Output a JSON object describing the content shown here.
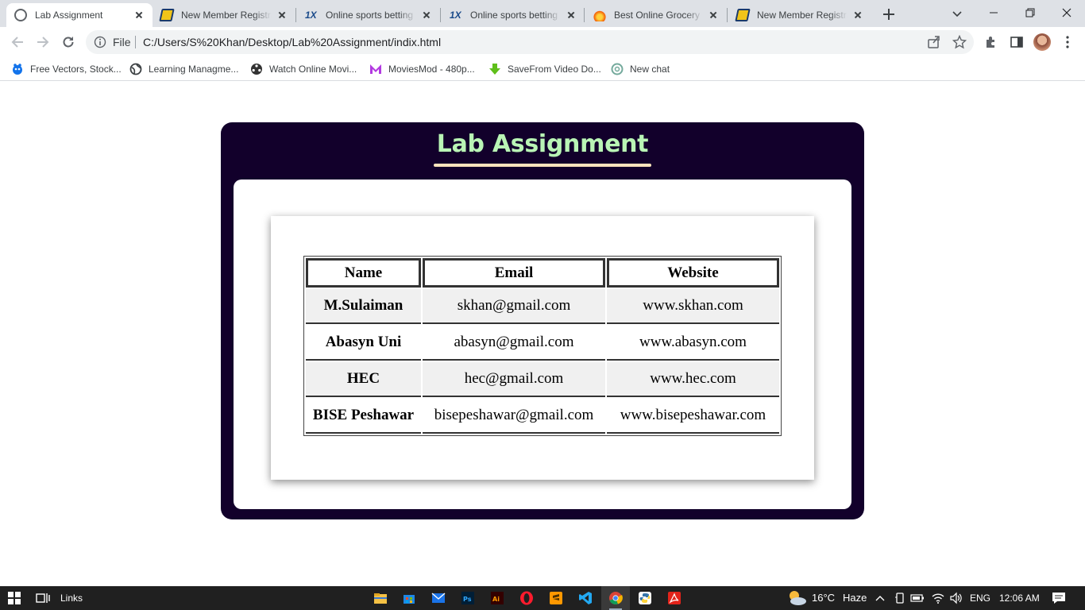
{
  "browser": {
    "tabs": [
      {
        "label": "Lab Assignment",
        "icon": "globe-icon",
        "active": true
      },
      {
        "label": "New Member Registra",
        "icon": "betting-site-icon",
        "active": false
      },
      {
        "label": "Online sports betting",
        "icon": "1x-icon",
        "active": false
      },
      {
        "label": "Online sports betting",
        "icon": "1x-icon",
        "active": false
      },
      {
        "label": "Best Online Grocery St",
        "icon": "flame-icon",
        "active": false
      },
      {
        "label": "New Member Registra",
        "icon": "betting-site-icon",
        "active": false
      }
    ],
    "address": {
      "scheme": "File",
      "url": "C:/Users/S%20Khan/Desktop/Lab%20Assignment/indix.html"
    },
    "bookmarks": [
      {
        "label": "Free Vectors, Stock...",
        "icon": "freepik-icon"
      },
      {
        "label": "Learning Managme...",
        "icon": "globe-icon"
      },
      {
        "label": "Watch Online Movi...",
        "icon": "film-reel-icon"
      },
      {
        "label": "MoviesMod - 480p...",
        "icon": "m-logo-icon"
      },
      {
        "label": "SaveFrom Video Do...",
        "icon": "download-arrow-icon"
      },
      {
        "label": "New chat",
        "icon": "chatgpt-icon"
      }
    ]
  },
  "page": {
    "title": "Lab Assignment",
    "table": {
      "headers": [
        "Name",
        "Email",
        "Website"
      ],
      "rows": [
        {
          "name": "M.Sulaiman",
          "email": "skhan@gmail.com",
          "website": "www.skhan.com"
        },
        {
          "name": "Abasyn Uni",
          "email": "abasyn@gmail.com",
          "website": "www.abasyn.com"
        },
        {
          "name": "HEC",
          "email": "hec@gmail.com",
          "website": "www.hec.com"
        },
        {
          "name": "BISE Peshawar",
          "email": "bisepeshawar@gmail.com",
          "website": "www.bisepeshawar.com"
        }
      ]
    }
  },
  "taskbar": {
    "search_label": "Links",
    "weather": {
      "temp": "16°C",
      "condition": "Haze"
    },
    "language": "ENG",
    "time": "12:06 AM"
  },
  "colors": {
    "card_bg": "#12002b",
    "title_color": "#b9f5b5",
    "underline": "#fde4bd",
    "row_shade": "#f0f0f0"
  }
}
